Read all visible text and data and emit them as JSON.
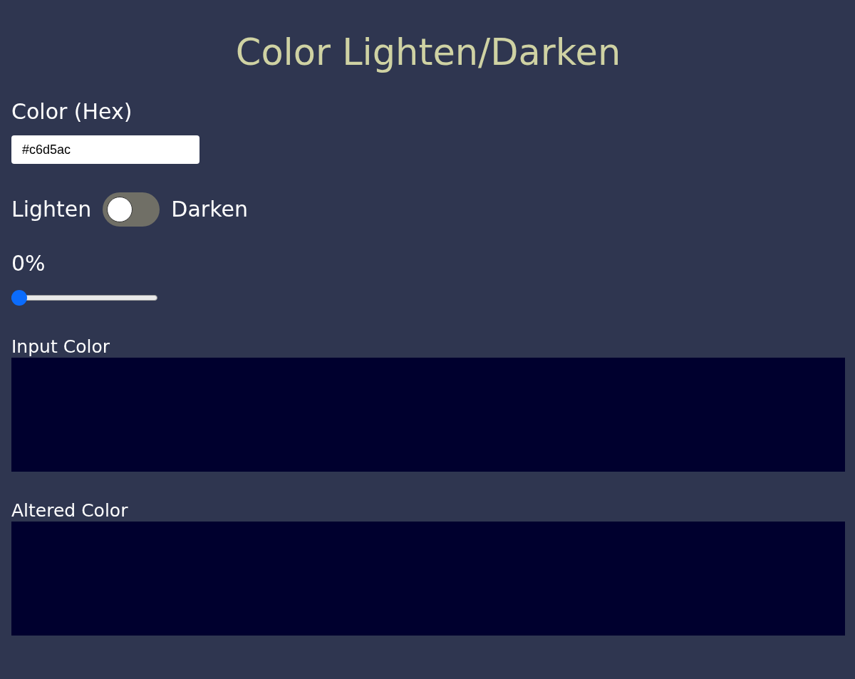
{
  "title": "Color Lighten/Darken",
  "hex_field": {
    "label": "Color (Hex)",
    "value": "#c6d5ac"
  },
  "mode_toggle": {
    "left_label": "Lighten",
    "right_label": "Darken",
    "on": false
  },
  "amount_slider": {
    "reading": "0%",
    "level": 0
  },
  "swatches": [
    {
      "label": "Input Color",
      "color": "#00002e"
    },
    {
      "label": "Altered Color",
      "color": "#00002e"
    }
  ]
}
